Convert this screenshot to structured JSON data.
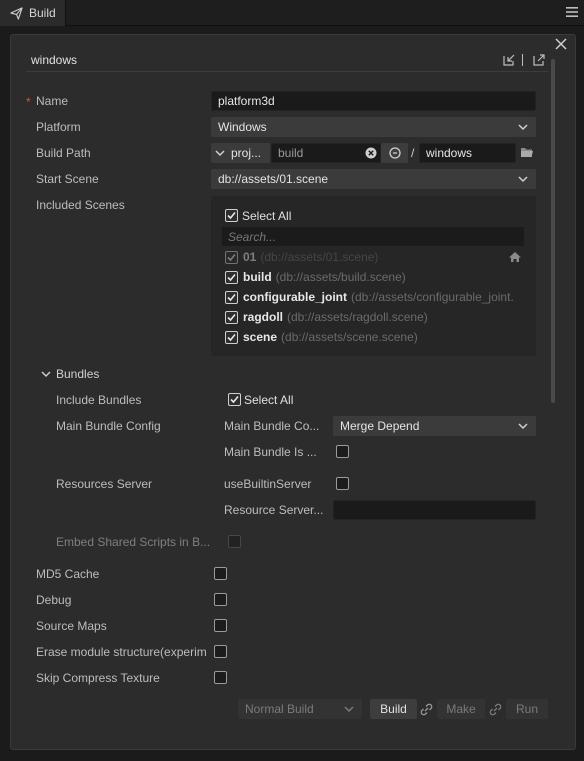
{
  "tab": {
    "title": "Build"
  },
  "header": {
    "title": "windows"
  },
  "form": {
    "name": {
      "label": "Name",
      "value": "platform3d",
      "required_mark": "*"
    },
    "platform": {
      "label": "Platform",
      "value": "Windows"
    },
    "build_path": {
      "label": "Build Path",
      "prefix": "proj...",
      "value": "build",
      "separator": "/",
      "suffix": "windows"
    },
    "start_scene": {
      "label": "Start Scene",
      "value": "db://assets/01.scene"
    },
    "included_scenes": {
      "label": "Included Scenes",
      "select_all": "Select All",
      "search_placeholder": "Search...",
      "items": [
        {
          "name": "01",
          "path": "(db://assets/01.scene)",
          "checked": true,
          "disabled": true
        },
        {
          "name": "build",
          "path": "(db://assets/build.scene)",
          "checked": true,
          "disabled": false
        },
        {
          "name": "configurable_joint",
          "path": "(db://assets/configurable_joint.",
          "checked": true,
          "disabled": false
        },
        {
          "name": "ragdoll",
          "path": "(db://assets/ragdoll.scene)",
          "checked": true,
          "disabled": false
        },
        {
          "name": "scene",
          "path": "(db://assets/scene.scene)",
          "checked": true,
          "disabled": false
        }
      ]
    },
    "bundles": {
      "title": "Bundles",
      "include_bundles": {
        "label": "Include Bundles",
        "select_all": "Select All"
      },
      "main_bundle_config": {
        "label": "Main Bundle Config",
        "compression_label": "Main Bundle Co...",
        "compression_value": "Merge Depend",
        "is_remote_label": "Main Bundle Is ..."
      },
      "resources_server": {
        "label": "Resources Server",
        "builtin_label": "useBuiltinServer",
        "server_label": "Resource Server..."
      },
      "embed_shared": {
        "label": "Embed Shared Scripts in B..."
      }
    },
    "md5_cache": {
      "label": "MD5 Cache"
    },
    "debug": {
      "label": "Debug"
    },
    "source_maps": {
      "label": "Source Maps"
    },
    "erase_module": {
      "label": "Erase module structure(experim"
    },
    "skip_compress": {
      "label": "Skip Compress Texture"
    }
  },
  "footer": {
    "build_mode": "Normal Build",
    "build": "Build",
    "make": "Make",
    "run": "Run"
  },
  "colors": {
    "panel": "#2c2c2c",
    "input": "#1a1a1a",
    "select": "#3b3b3b",
    "required": "#d4553c"
  }
}
